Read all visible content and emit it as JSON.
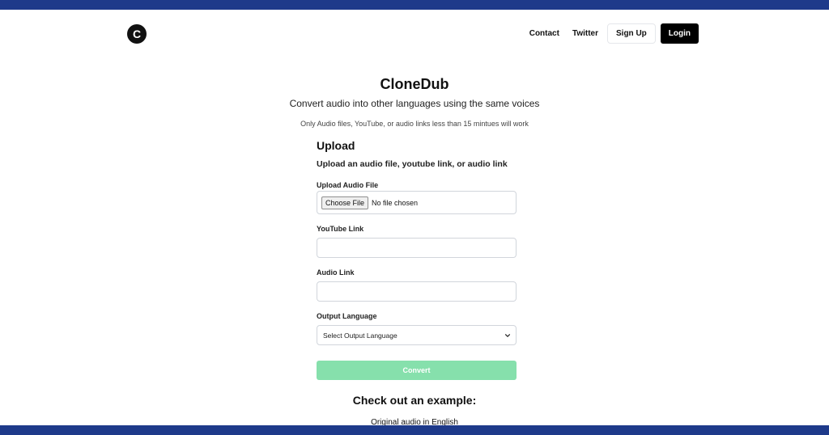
{
  "header": {
    "logo_letter": "C",
    "nav": {
      "contact": "Contact",
      "twitter": "Twitter",
      "signup": "Sign Up",
      "login": "Login"
    }
  },
  "hero": {
    "title": "CloneDub",
    "subtitle": "Convert audio into other languages using the same voices",
    "note": "Only Audio files, YouTube, or audio links less than 15 mintues will work"
  },
  "form": {
    "heading": "Upload",
    "description": "Upload an audio file, youtube link, or audio link",
    "upload_label": "Upload Audio File",
    "choose_file": "Choose File",
    "no_file": "No file chosen",
    "youtube_label": "YouTube Link",
    "youtube_value": "",
    "audio_label": "Audio Link",
    "audio_value": "",
    "language_label": "Output Language",
    "language_selected": "Select Output Language",
    "convert": "Convert"
  },
  "example": {
    "title": "Check out an example:",
    "subtitle": "Original audio in English"
  },
  "colors": {
    "frame": "#1e3a8a",
    "convert_disabled": "#86e0ac",
    "login_bg": "#000000"
  },
  "icons": {
    "select_arrow": "chevron-down-icon"
  }
}
